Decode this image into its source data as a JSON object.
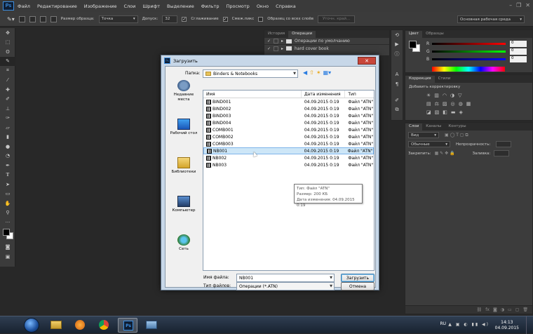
{
  "app": {
    "logo": "Ps"
  },
  "menu": [
    "Файл",
    "Редактирование",
    "Изображение",
    "Слои",
    "Шрифт",
    "Выделение",
    "Фильтр",
    "Просмотр",
    "Окно",
    "Справка"
  ],
  "options": {
    "sample_size_label": "Размер образца:",
    "sample_size_value": "Точка",
    "tolerance_label": "Допуск:",
    "tolerance_value": "32",
    "antialias_label": "Сглаживание",
    "contiguous_label": "Смеж.пикс",
    "all_layers_label": "Образец со всех слоёв",
    "refine_edge_label": "Уточн. край...",
    "workspace_value": "Основная рабочая среда"
  },
  "history_panel": {
    "tabs": [
      "История",
      "Операции"
    ],
    "items": [
      "Операции по умолчанию",
      "hard cover book"
    ]
  },
  "color_panel": {
    "tabs": [
      "Цвет",
      "Образцы"
    ],
    "channels": [
      {
        "name": "R",
        "value": "0"
      },
      {
        "name": "G",
        "value": "0"
      },
      {
        "name": "B",
        "value": "0"
      }
    ]
  },
  "adjust_panel": {
    "tabs": [
      "Коррекция",
      "Стили"
    ],
    "subtitle": "Добавить корректировку"
  },
  "layers_panel": {
    "tabs": [
      "Слои",
      "Каналы",
      "Контуры"
    ],
    "kind": "Вид",
    "blend": "Обычные",
    "opacity_label": "Непрозрачность:",
    "lock_label": "Закрепить:",
    "fill_label": "Заливка:"
  },
  "dialog": {
    "title": "Загрузить",
    "folder_label": "Папка:",
    "folder_value": "Binders & Notebooks",
    "places": [
      "Недавние места",
      "Рабочий стол",
      "Библиотеки",
      "Компьютер",
      "Сеть"
    ],
    "columns": [
      "Имя",
      "Дата изменения",
      "Тип"
    ],
    "files": [
      {
        "name": "BIND001",
        "date": "04.09.2015 0:19",
        "type": "Файл \"ATN\""
      },
      {
        "name": "BIND002",
        "date": "04.09.2015 0:19",
        "type": "Файл \"ATN\""
      },
      {
        "name": "BIND003",
        "date": "04.09.2015 0:19",
        "type": "Файл \"ATN\""
      },
      {
        "name": "BIND004",
        "date": "04.09.2015 0:19",
        "type": "Файл \"ATN\""
      },
      {
        "name": "COMB001",
        "date": "04.09.2015 0:19",
        "type": "Файл \"ATN\""
      },
      {
        "name": "COMB002",
        "date": "04.09.2015 0:19",
        "type": "Файл \"ATN\""
      },
      {
        "name": "COMB003",
        "date": "04.09.2015 0:19",
        "type": "Файл \"ATN\""
      },
      {
        "name": "NB001",
        "date": "04.09.2015 0:19",
        "type": "Файл \"ATN\""
      },
      {
        "name": "NB002",
        "date": "04.09.2015 0:19",
        "type": "Файл \"ATN\""
      },
      {
        "name": "NB003",
        "date": "04.09.2015 0:19",
        "type": "Файл \"ATN\""
      }
    ],
    "tooltip": [
      "Тип: Файл \"ATN\"",
      "Размер: 200 КБ",
      "Дата изменения: 04.09.2015 0:19"
    ],
    "filename_label": "Имя файла:",
    "filename_value": "NB001",
    "filetype_label": "Тип файлов:",
    "filetype_value": "Операции (*.ATN)",
    "load_button": "Загрузить",
    "cancel_button": "Отмена"
  },
  "taskbar": {
    "lang": "RU",
    "time": "14:13",
    "date": "04.09.2015"
  }
}
